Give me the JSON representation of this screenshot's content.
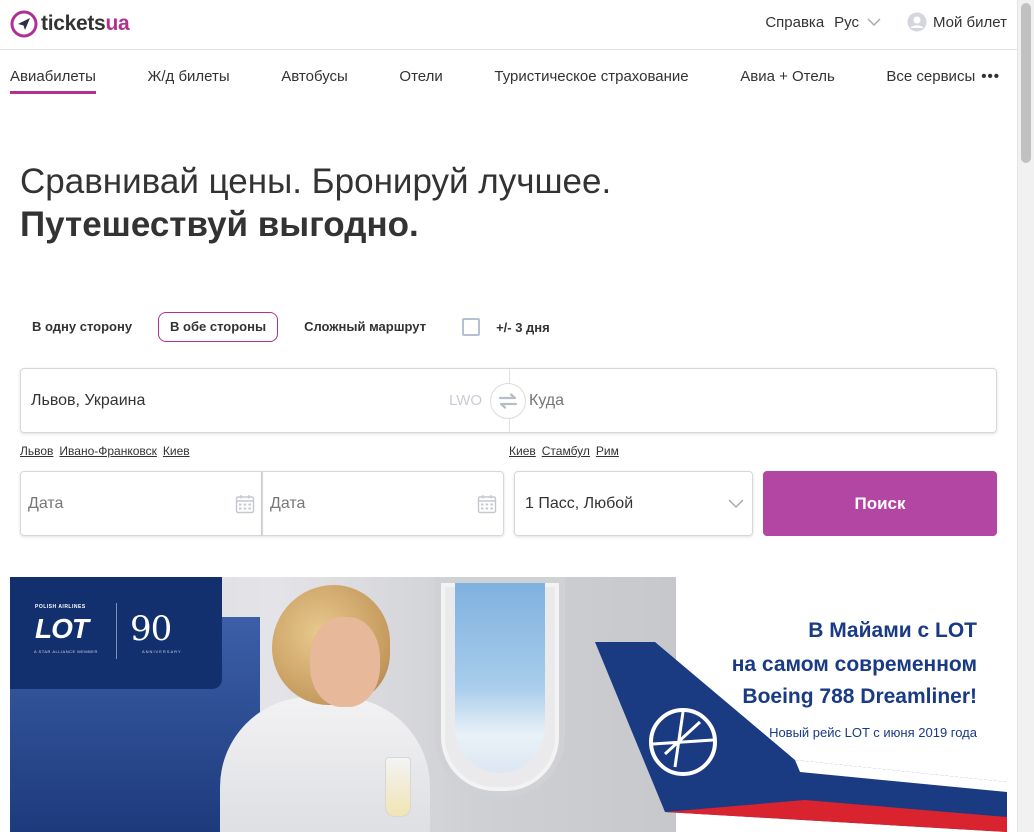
{
  "header": {
    "logo_main": "tickets",
    "logo_accent": "ua",
    "help": "Справка",
    "language": "Рус",
    "my_ticket": "Мой билет"
  },
  "nav": {
    "items": [
      {
        "label": "Авиабилеты",
        "active": true
      },
      {
        "label": "Ж/д билеты"
      },
      {
        "label": "Автобусы"
      },
      {
        "label": "Отели"
      },
      {
        "label": "Туристическое страхование"
      },
      {
        "label": "Авиа + Отель"
      },
      {
        "label": "Все сервисы"
      }
    ],
    "more_dots": "•••"
  },
  "hero": {
    "line1": "Сравнивай цены. Бронируй лучшее.",
    "line2": "Путешествуй выгодно."
  },
  "trip": {
    "one_way": "В одну сторону",
    "round_trip": "В обе стороны",
    "multi": "Сложный маршрут",
    "flex_dates": "+/- 3 дня",
    "selected": "В обе стороны"
  },
  "route": {
    "from_value": "Львов, Украина",
    "from_code": "LWO",
    "to_placeholder": "Куда"
  },
  "quick_from": [
    "Львов",
    "Ивано-Франковск",
    "Киев"
  ],
  "quick_to": [
    "Киев",
    "Стамбул",
    "Рим"
  ],
  "dates": {
    "depart_placeholder": "Дата",
    "return_placeholder": "Дата"
  },
  "passengers": {
    "value": "1 Пасс, Любой"
  },
  "search_button": "Поиск",
  "banner": {
    "line1": "В Майами с LOT",
    "line2": "на самом современном",
    "line3": "Boeing 788 Dreamliner!",
    "line4": "Новый рейс LOT с июня 2019 года",
    "lot_logo": "LOT",
    "lot_small_top": "POLISH AIRLINES",
    "lot_small_bottom": "A STAR ALLIANCE MEMBER",
    "anniv_number": "90",
    "anniv_label": "ANNIVERSARY"
  },
  "colors": {
    "accent": "#b0318f",
    "search_button": "#b346a3",
    "banner_text": "#193a85"
  }
}
